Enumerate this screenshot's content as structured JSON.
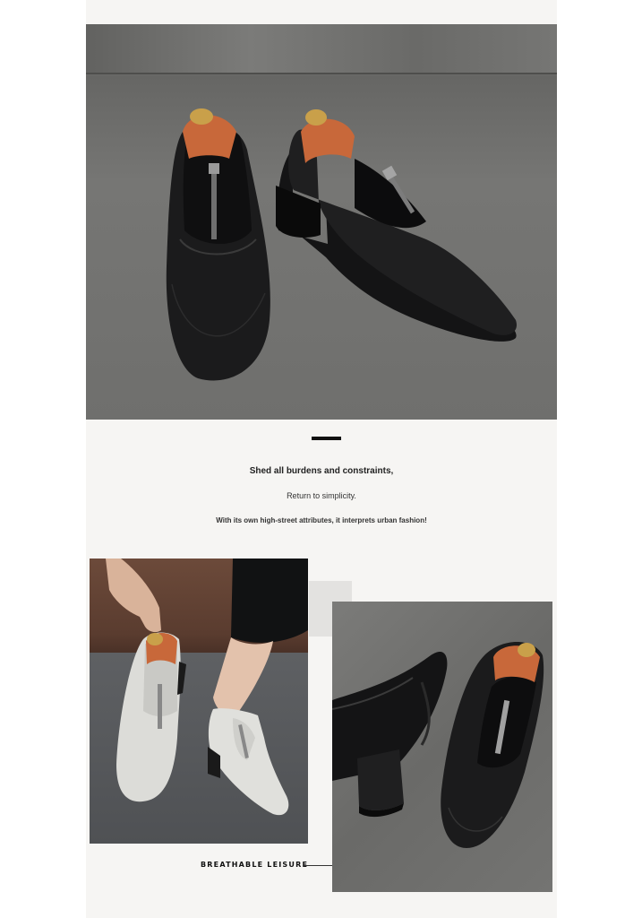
{
  "copy": {
    "line1": "Shed all burdens and constraints,",
    "line2": "Return to simplicity.",
    "line3": "With its own high-street attributes, it interprets urban fashion!"
  },
  "tagline": "BREATHABLE LEISURE",
  "colors": {
    "panel_background": "#f6f5f3",
    "shoe_black": "#1b1b1c",
    "shoe_white": "#dcdcd8",
    "shoe_tree_wood": "#c8683a",
    "shoe_tree_knob": "#c9a04a"
  }
}
